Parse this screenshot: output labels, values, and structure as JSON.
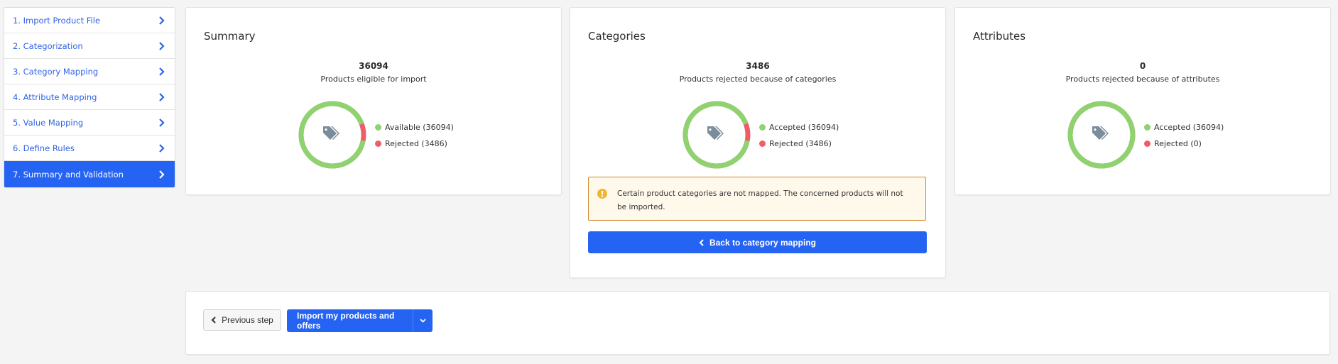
{
  "sidebar": {
    "steps": [
      {
        "label": "1. Import Product File"
      },
      {
        "label": "2. Categorization"
      },
      {
        "label": "3. Category Mapping"
      },
      {
        "label": "4. Attribute Mapping"
      },
      {
        "label": "5. Value Mapping"
      },
      {
        "label": "6. Define Rules"
      },
      {
        "label": "7. Summary and Validation",
        "active": true
      }
    ]
  },
  "colors": {
    "accent": "#2563f3",
    "accepted": "#8ed36f",
    "rejected": "#ef5d68",
    "icon": "#7b8c9c",
    "warning": "#f2b531"
  },
  "summary": {
    "title": "Summary",
    "count": "36094",
    "subtitle": "Products eligible for import",
    "legend": [
      "Available (36094)",
      "Rejected (3486)"
    ],
    "accepted_fraction": 0.912
  },
  "categories": {
    "title": "Categories",
    "count": "3486",
    "subtitle": "Products rejected because of categories",
    "legend": [
      "Accepted (36094)",
      "Rejected (3486)"
    ],
    "accepted_fraction": 0.912,
    "warning_text": "Certain product categories are not mapped. The concerned products will not be imported.",
    "back_button": "Back to category mapping"
  },
  "attributes": {
    "title": "Attributes",
    "count": "0",
    "subtitle": "Products rejected because of attributes",
    "legend": [
      "Accepted (36094)",
      "Rejected (0)"
    ],
    "accepted_fraction": 1.0
  },
  "footer": {
    "prev_label": "Previous step",
    "import_label": "Import my products and offers"
  },
  "icons": {
    "step_chevron": "chevron-right-icon",
    "donut_center": "tags-icon",
    "warning": "exclamation-circle-icon",
    "back": "chevron-left-icon",
    "dropdown": "chevron-down-icon"
  }
}
